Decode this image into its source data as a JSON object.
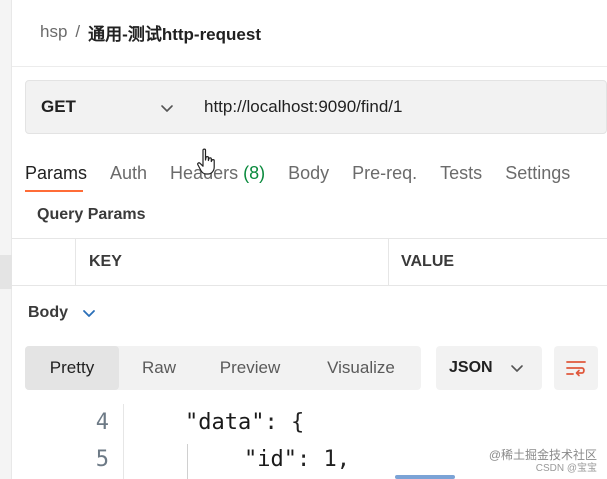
{
  "breadcrumb": {
    "workspace": "hsp",
    "separator": "/",
    "request_name": "通用-测试http-request"
  },
  "request": {
    "method": "GET",
    "url": "http://localhost:9090/find/1"
  },
  "tabs": [
    {
      "label": "Params",
      "active": true
    },
    {
      "label": "Auth",
      "active": false
    },
    {
      "label": "Headers",
      "count": "(8)",
      "active": false
    },
    {
      "label": "Body",
      "active": false
    },
    {
      "label": "Pre-req.",
      "active": false
    },
    {
      "label": "Tests",
      "active": false
    },
    {
      "label": "Settings",
      "active": false
    }
  ],
  "query_params": {
    "title": "Query Params",
    "columns": [
      "KEY",
      "VALUE"
    ]
  },
  "response": {
    "body_label": "Body",
    "view_modes": [
      "Pretty",
      "Raw",
      "Preview",
      "Visualize"
    ],
    "active_mode": "Pretty",
    "format": "JSON",
    "code_lines": [
      {
        "number": "4",
        "key": "\"data\"",
        "rest": ": {"
      },
      {
        "number": "5",
        "key": "\"id\"",
        "rest": ": 1,"
      }
    ]
  },
  "watermark": {
    "line1": "@稀土掘金技术社区",
    "line2": "CSDN @宝宝"
  },
  "colors": {
    "accent": "#ff6c37",
    "count_green": "#0a8a3d"
  },
  "icons": [
    "chevron-down-icon",
    "hand-cursor-icon",
    "wrap-lines-icon"
  ]
}
